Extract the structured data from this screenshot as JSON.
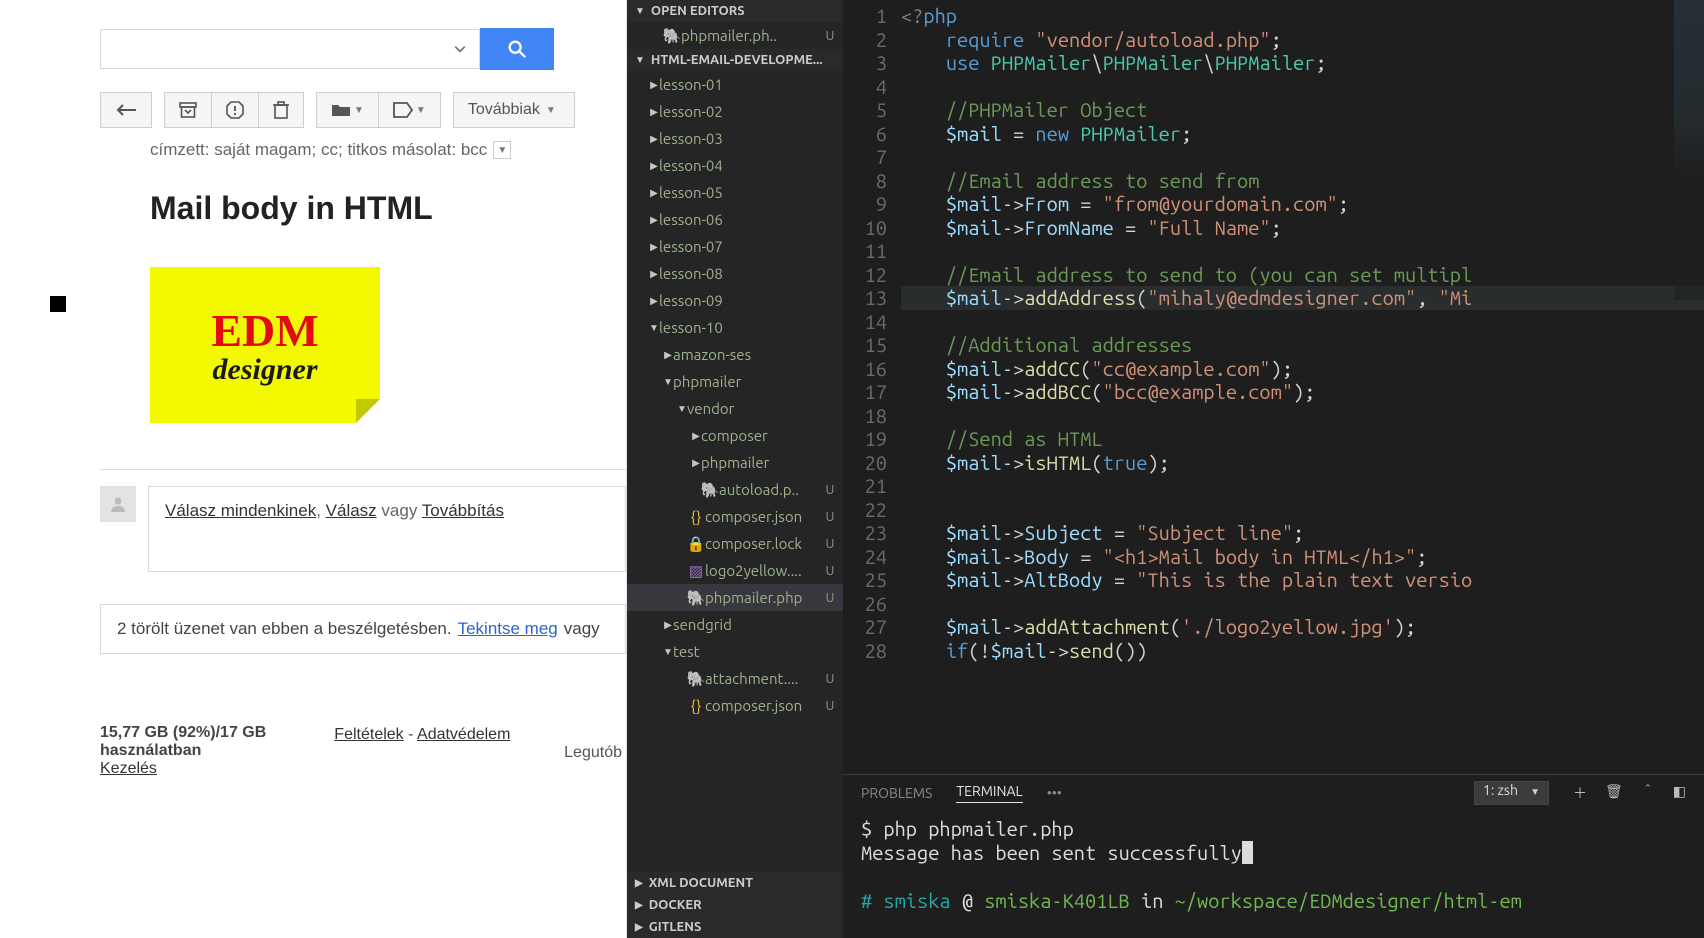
{
  "gmail": {
    "recipients": "címzett: saját magam; cc; titkos másolat: bcc",
    "subject": "Mail body in HTML",
    "logo": {
      "line1": "EDM",
      "line2": "designer"
    },
    "reply_all": "Válasz mindenkinek",
    "reply": "Válasz",
    "or": "vagy",
    "forward": "Továbbítás",
    "deleted_prefix": "2 törölt üzenet van ebben a beszélgetésben. ",
    "deleted_link": "Tekintse meg",
    "deleted_suffix": " vagy",
    "storage_line1": "15,77 GB (92%)/17 GB",
    "storage_line2": "használatban",
    "manage": "Kezelés",
    "terms": "Feltételek",
    "separator": " - ",
    "privacy": "Adatvédelem",
    "more_label": "Továbbiak",
    "last_activity": "Legutób"
  },
  "explorer": {
    "open_editors": "OPEN EDITORS",
    "open_editor_file": "phpmailer.ph..",
    "project_header": "HTML-EMAIL-DEVELOPME...",
    "items": [
      {
        "lvl": 0,
        "caret": "▶",
        "label": "lesson-01"
      },
      {
        "lvl": 0,
        "caret": "▶",
        "label": "lesson-02"
      },
      {
        "lvl": 0,
        "caret": "▶",
        "label": "lesson-03"
      },
      {
        "lvl": 0,
        "caret": "▶",
        "label": "lesson-04"
      },
      {
        "lvl": 0,
        "caret": "▶",
        "label": "lesson-05"
      },
      {
        "lvl": 0,
        "caret": "▶",
        "label": "lesson-06"
      },
      {
        "lvl": 0,
        "caret": "▶",
        "label": "lesson-07"
      },
      {
        "lvl": 0,
        "caret": "▶",
        "label": "lesson-08"
      },
      {
        "lvl": 0,
        "caret": "▶",
        "label": "lesson-09"
      },
      {
        "lvl": 0,
        "caret": "▼",
        "label": "lesson-10",
        "dot": true
      },
      {
        "lvl": 1,
        "caret": "▶",
        "label": "amazon-ses",
        "dot": true
      },
      {
        "lvl": 1,
        "caret": "▼",
        "label": "phpmailer",
        "dot": true
      },
      {
        "lvl": 2,
        "caret": "▼",
        "label": "vendor",
        "dot": true
      },
      {
        "lvl": 3,
        "caret": "▶",
        "label": "composer",
        "dot": true
      },
      {
        "lvl": 3,
        "caret": "▶",
        "label": "phpmailer",
        "dot": true
      },
      {
        "lvl": 3,
        "caret": "",
        "icon": "php",
        "label": "autoload.p..",
        "status": "U"
      },
      {
        "lvl": 2,
        "caret": "",
        "icon": "json",
        "label": "composer.json",
        "status": "U"
      },
      {
        "lvl": 2,
        "caret": "",
        "icon": "lock",
        "label": "composer.lock",
        "status": "U"
      },
      {
        "lvl": 2,
        "caret": "",
        "icon": "img",
        "label": "logo2yellow....",
        "status": "U"
      },
      {
        "lvl": 2,
        "caret": "",
        "icon": "php",
        "label": "phpmailer.php",
        "status": "U",
        "selected": true
      },
      {
        "lvl": 1,
        "caret": "▶",
        "label": "sendgrid",
        "dot": true
      },
      {
        "lvl": 1,
        "caret": "▼",
        "label": "test",
        "dot": true
      },
      {
        "lvl": 2,
        "caret": "",
        "icon": "php",
        "label": "attachment....",
        "status": "U"
      },
      {
        "lvl": 2,
        "caret": "",
        "icon": "json",
        "label": "composer.json",
        "status": "U"
      }
    ],
    "bottom_sections": [
      "XML DOCUMENT",
      "DOCKER",
      "GITLENS"
    ]
  },
  "code": {
    "line_start": 1,
    "line_end": 28,
    "lines": [
      [
        {
          "c": "tk-tag",
          "t": "<?"
        },
        {
          "c": "tk-key",
          "t": "php"
        }
      ],
      [
        {
          "c": "",
          "t": "    "
        },
        {
          "c": "tk-key",
          "t": "require"
        },
        {
          "c": "",
          "t": " "
        },
        {
          "c": "tk-str",
          "t": "\"vendor/autoload.php\""
        },
        {
          "c": "tk-punc",
          "t": ";"
        }
      ],
      [
        {
          "c": "",
          "t": "    "
        },
        {
          "c": "tk-key",
          "t": "use"
        },
        {
          "c": "",
          "t": " "
        },
        {
          "c": "tk-type",
          "t": "PHPMailer"
        },
        {
          "c": "tk-punc",
          "t": "\\"
        },
        {
          "c": "tk-type",
          "t": "PHPMailer"
        },
        {
          "c": "tk-punc",
          "t": "\\"
        },
        {
          "c": "tk-type",
          "t": "PHPMailer"
        },
        {
          "c": "tk-punc",
          "t": ";"
        }
      ],
      [],
      [
        {
          "c": "",
          "t": "    "
        },
        {
          "c": "tk-com",
          "t": "//PHPMailer Object"
        }
      ],
      [
        {
          "c": "",
          "t": "    "
        },
        {
          "c": "tk-var",
          "t": "$mail"
        },
        {
          "c": "",
          "t": " "
        },
        {
          "c": "tk-op",
          "t": "="
        },
        {
          "c": "",
          "t": " "
        },
        {
          "c": "tk-key",
          "t": "new"
        },
        {
          "c": "",
          "t": " "
        },
        {
          "c": "tk-type",
          "t": "PHPMailer"
        },
        {
          "c": "tk-punc",
          "t": ";"
        }
      ],
      [],
      [
        {
          "c": "",
          "t": "    "
        },
        {
          "c": "tk-com",
          "t": "//Email address to send from"
        }
      ],
      [
        {
          "c": "",
          "t": "    "
        },
        {
          "c": "tk-var",
          "t": "$mail"
        },
        {
          "c": "tk-punc",
          "t": "->"
        },
        {
          "c": "tk-var",
          "t": "From"
        },
        {
          "c": "",
          "t": " "
        },
        {
          "c": "tk-op",
          "t": "="
        },
        {
          "c": "",
          "t": " "
        },
        {
          "c": "tk-str",
          "t": "\"from@yourdomain.com\""
        },
        {
          "c": "tk-punc",
          "t": ";"
        }
      ],
      [
        {
          "c": "",
          "t": "    "
        },
        {
          "c": "tk-var",
          "t": "$mail"
        },
        {
          "c": "tk-punc",
          "t": "->"
        },
        {
          "c": "tk-var",
          "t": "FromName"
        },
        {
          "c": "",
          "t": " "
        },
        {
          "c": "tk-op",
          "t": "="
        },
        {
          "c": "",
          "t": " "
        },
        {
          "c": "tk-str",
          "t": "\"Full Name\""
        },
        {
          "c": "tk-punc",
          "t": ";"
        }
      ],
      [],
      [
        {
          "c": "",
          "t": "    "
        },
        {
          "c": "tk-com",
          "t": "//Email address to send to (you can set multipl"
        }
      ],
      [
        {
          "c": "",
          "t": "    "
        },
        {
          "c": "tk-var",
          "t": "$mail"
        },
        {
          "c": "tk-punc",
          "t": "->"
        },
        {
          "c": "tk-fn",
          "t": "addAddress"
        },
        {
          "c": "tk-punc",
          "t": "("
        },
        {
          "c": "tk-str",
          "t": "\"mihaly@edmdesigner.com\""
        },
        {
          "c": "tk-punc",
          "t": ", "
        },
        {
          "c": "tk-str",
          "t": "\"Mi"
        }
      ],
      [],
      [
        {
          "c": "",
          "t": "    "
        },
        {
          "c": "tk-com",
          "t": "//Additional addresses"
        }
      ],
      [
        {
          "c": "",
          "t": "    "
        },
        {
          "c": "tk-var",
          "t": "$mail"
        },
        {
          "c": "tk-punc",
          "t": "->"
        },
        {
          "c": "tk-fn",
          "t": "addCC"
        },
        {
          "c": "tk-punc",
          "t": "("
        },
        {
          "c": "tk-str",
          "t": "\"cc@example.com\""
        },
        {
          "c": "tk-punc",
          "t": ");"
        }
      ],
      [
        {
          "c": "",
          "t": "    "
        },
        {
          "c": "tk-var",
          "t": "$mail"
        },
        {
          "c": "tk-punc",
          "t": "->"
        },
        {
          "c": "tk-fn",
          "t": "addBCC"
        },
        {
          "c": "tk-punc",
          "t": "("
        },
        {
          "c": "tk-str",
          "t": "\"bcc@example.com\""
        },
        {
          "c": "tk-punc",
          "t": ");"
        }
      ],
      [],
      [
        {
          "c": "",
          "t": "    "
        },
        {
          "c": "tk-com",
          "t": "//Send as HTML"
        }
      ],
      [
        {
          "c": "",
          "t": "    "
        },
        {
          "c": "tk-var",
          "t": "$mail"
        },
        {
          "c": "tk-punc",
          "t": "->"
        },
        {
          "c": "tk-fn",
          "t": "isHTML"
        },
        {
          "c": "tk-punc",
          "t": "("
        },
        {
          "c": "tk-const",
          "t": "true"
        },
        {
          "c": "tk-punc",
          "t": ");"
        }
      ],
      [],
      [],
      [
        {
          "c": "",
          "t": "    "
        },
        {
          "c": "tk-var",
          "t": "$mail"
        },
        {
          "c": "tk-punc",
          "t": "->"
        },
        {
          "c": "tk-var",
          "t": "Subject"
        },
        {
          "c": "",
          "t": " "
        },
        {
          "c": "tk-op",
          "t": "="
        },
        {
          "c": "",
          "t": " "
        },
        {
          "c": "tk-str",
          "t": "\"Subject line\""
        },
        {
          "c": "tk-punc",
          "t": ";"
        }
      ],
      [
        {
          "c": "",
          "t": "    "
        },
        {
          "c": "tk-var",
          "t": "$mail"
        },
        {
          "c": "tk-punc",
          "t": "->"
        },
        {
          "c": "tk-var",
          "t": "Body"
        },
        {
          "c": "",
          "t": " "
        },
        {
          "c": "tk-op",
          "t": "="
        },
        {
          "c": "",
          "t": " "
        },
        {
          "c": "tk-str",
          "t": "\"<h1>Mail body in HTML</h1>\""
        },
        {
          "c": "tk-punc",
          "t": ";"
        }
      ],
      [
        {
          "c": "",
          "t": "    "
        },
        {
          "c": "tk-var",
          "t": "$mail"
        },
        {
          "c": "tk-punc",
          "t": "->"
        },
        {
          "c": "tk-var",
          "t": "AltBody"
        },
        {
          "c": "",
          "t": " "
        },
        {
          "c": "tk-op",
          "t": "="
        },
        {
          "c": "",
          "t": " "
        },
        {
          "c": "tk-str",
          "t": "\"This is the plain text versio"
        }
      ],
      [],
      [
        {
          "c": "",
          "t": "    "
        },
        {
          "c": "tk-var",
          "t": "$mail"
        },
        {
          "c": "tk-punc",
          "t": "->"
        },
        {
          "c": "tk-fn",
          "t": "addAttachment"
        },
        {
          "c": "tk-punc",
          "t": "("
        },
        {
          "c": "tk-str",
          "t": "'./logo2yellow.jpg'"
        },
        {
          "c": "tk-punc",
          "t": ");"
        }
      ],
      [
        {
          "c": "",
          "t": "    "
        },
        {
          "c": "tk-key",
          "t": "if"
        },
        {
          "c": "tk-punc",
          "t": "(!"
        },
        {
          "c": "tk-var",
          "t": "$mail"
        },
        {
          "c": "tk-punc",
          "t": "->"
        },
        {
          "c": "tk-fn",
          "t": "send"
        },
        {
          "c": "tk-punc",
          "t": "())"
        }
      ]
    ],
    "highlight_line": 13
  },
  "panel": {
    "tabs": {
      "problems": "PROBLEMS",
      "terminal": "TERMINAL",
      "more": "•••"
    },
    "shell": "1: zsh",
    "terminal_lines": [
      [
        {
          "c": "term-white",
          "t": "$ "
        },
        {
          "c": "term-white",
          "t": "php phpmailer.php"
        }
      ],
      [
        {
          "c": "term-white",
          "t": "Message has been sent successfully"
        },
        {
          "c": "term-cursor",
          "t": " "
        }
      ],
      [],
      [
        {
          "c": "term-cyan",
          "t": "# smiska"
        },
        {
          "c": "term-white",
          "t": " @ "
        },
        {
          "c": "term-green",
          "t": "smiska-K401LB"
        },
        {
          "c": "term-white",
          "t": " in "
        },
        {
          "c": "term-green",
          "t": "~/workspace/EDMdesigner/html-em"
        }
      ]
    ]
  }
}
